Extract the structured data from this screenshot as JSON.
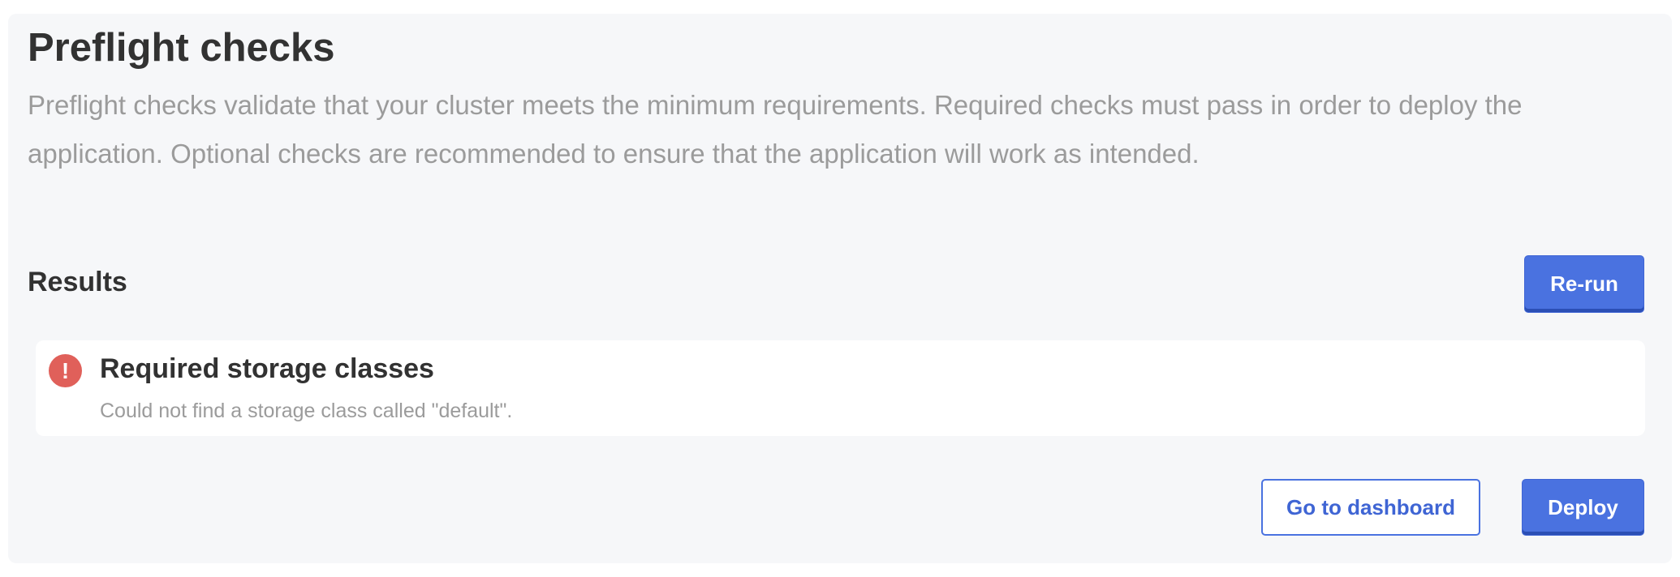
{
  "header": {
    "title": "Preflight checks",
    "description": "Preflight checks validate that your cluster meets the minimum requirements. Required checks must pass in order to deploy the application. Optional checks are recommended to ensure that the application will work as intended."
  },
  "results": {
    "heading": "Results",
    "rerun_label": "Re-run",
    "items": [
      {
        "status": "error",
        "icon": "error-icon",
        "icon_glyph": "!",
        "title": "Required storage classes",
        "message": "Could not find a storage class called \"default\"."
      }
    ]
  },
  "footer": {
    "dashboard_label": "Go to dashboard",
    "deploy_label": "Deploy"
  },
  "colors": {
    "primary": "#4a72e0",
    "error": "#e0605a",
    "panel_bg": "#f6f7f9"
  }
}
